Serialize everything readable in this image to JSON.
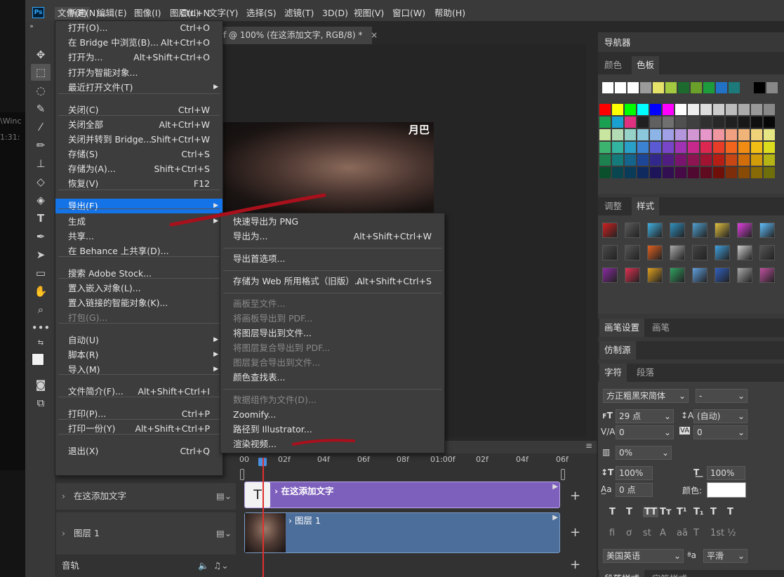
{
  "menubar": {
    "items": [
      "文件(F)",
      "编辑(E)",
      "图像(I)",
      "图层(L)",
      "文字(Y)",
      "选择(S)",
      "滤镜(T)",
      "3D(D)",
      "视图(V)",
      "窗口(W)",
      "帮助(H)"
    ],
    "logo": "Ps"
  },
  "document": {
    "tab_title": "f @ 100% (在这添加文字, RGB/8) *",
    "tab_close": "×",
    "overlay_text": "月巴"
  },
  "ghost_window": {
    "line1": "\\Winc",
    "line2": "1:31:"
  },
  "file_menu": {
    "items": [
      {
        "label": "新建(N)...",
        "shortcut": "Ctrl+N"
      },
      {
        "label": "打开(O)...",
        "shortcut": "Ctrl+O"
      },
      {
        "label": "在 Bridge 中浏览(B)...",
        "shortcut": "Alt+Ctrl+O"
      },
      {
        "label": "打开为...",
        "shortcut": "Alt+Shift+Ctrl+O"
      },
      {
        "label": "打开为智能对象...",
        "shortcut": ""
      },
      {
        "label": "最近打开文件(T)",
        "shortcut": ""
      },
      {
        "label": "关闭(C)",
        "shortcut": "Ctrl+W"
      },
      {
        "label": "关闭全部",
        "shortcut": "Alt+Ctrl+W"
      },
      {
        "label": "关闭并转到 Bridge...",
        "shortcut": "Shift+Ctrl+W"
      },
      {
        "label": "存储(S)",
        "shortcut": "Ctrl+S"
      },
      {
        "label": "存储为(A)...",
        "shortcut": "Shift+Ctrl+S"
      },
      {
        "label": "恢复(V)",
        "shortcut": "F12"
      },
      {
        "label": "导出(E)",
        "shortcut": ""
      },
      {
        "label": "生成",
        "shortcut": ""
      },
      {
        "label": "共享...",
        "shortcut": ""
      },
      {
        "label": "在 Behance 上共享(D)...",
        "shortcut": ""
      },
      {
        "label": "搜索 Adobe Stock...",
        "shortcut": ""
      },
      {
        "label": "置入嵌入对象(L)...",
        "shortcut": ""
      },
      {
        "label": "置入链接的智能对象(K)...",
        "shortcut": ""
      },
      {
        "label": "打包(G)...",
        "shortcut": ""
      },
      {
        "label": "自动(U)",
        "shortcut": ""
      },
      {
        "label": "脚本(R)",
        "shortcut": ""
      },
      {
        "label": "导入(M)",
        "shortcut": ""
      },
      {
        "label": "文件简介(F)...",
        "shortcut": "Alt+Shift+Ctrl+I"
      },
      {
        "label": "打印(P)...",
        "shortcut": "Ctrl+P"
      },
      {
        "label": "打印一份(Y)",
        "shortcut": "Alt+Shift+Ctrl+P"
      },
      {
        "label": "退出(X)",
        "shortcut": "Ctrl+Q"
      }
    ]
  },
  "export_menu": {
    "items": [
      {
        "label": "快速导出为 PNG",
        "shortcut": ""
      },
      {
        "label": "导出为...",
        "shortcut": "Alt+Shift+Ctrl+W"
      },
      {
        "label": "导出首选项...",
        "shortcut": ""
      },
      {
        "label": "存储为 Web 所用格式（旧版）...",
        "shortcut": "Alt+Shift+Ctrl+S"
      },
      {
        "label": "画板至文件...",
        "shortcut": ""
      },
      {
        "label": "将画板导出到 PDF...",
        "shortcut": ""
      },
      {
        "label": "将图层导出到文件...",
        "shortcut": ""
      },
      {
        "label": "将图层复合导出到 PDF...",
        "shortcut": ""
      },
      {
        "label": "图层复合导出到文件...",
        "shortcut": ""
      },
      {
        "label": "颜色查找表...",
        "shortcut": ""
      },
      {
        "label": "数据组作为文件(D)...",
        "shortcut": ""
      },
      {
        "label": "Zoomify...",
        "shortcut": ""
      },
      {
        "label": "路径到 Illustrator...",
        "shortcut": ""
      },
      {
        "label": "渲染视频...",
        "shortcut": ""
      }
    ]
  },
  "timeline": {
    "ruler": [
      "00",
      "02f",
      "04f",
      "06f",
      "08f",
      "01:00f",
      "02f",
      "04f",
      "06f"
    ],
    "tracks": [
      {
        "label": "在这添加文字",
        "clip_label": "在这添加文字"
      },
      {
        "label": "图层 1",
        "clip_label": "图层 1"
      },
      {
        "label": "音轨"
      }
    ],
    "text_clip_glyph": "T"
  },
  "panels": {
    "navigator": "导航器",
    "color_tabs": [
      "颜色",
      "色板"
    ],
    "adjust_tabs": [
      "调整",
      "样式"
    ],
    "brush_tabs": [
      "画笔设置",
      "画笔"
    ],
    "clone_source": "仿制源",
    "char_tabs": [
      "字符",
      "段落"
    ],
    "bottom_tabs": [
      "段落样式",
      "字符样式"
    ],
    "character": {
      "font_family": "方正粗黑宋简体",
      "font_style": "-",
      "size": "29 点",
      "leading": "(自动)",
      "kerning": "0",
      "tracking": "0",
      "tsume": "0%",
      "vscale": "100%",
      "hscale": "100%",
      "baseline": "0 点",
      "color_label": "颜色:",
      "language": "美国英语",
      "antialias": "平滑",
      "aa_icon": "ªa",
      "type_buttons": [
        "T",
        "T",
        "TT",
        "Tт",
        "T¹",
        "T₁",
        "T",
        "T"
      ],
      "ot_buttons": [
        "fi",
        "ơ",
        "st",
        "A",
        "aā",
        "T",
        "1st",
        "½"
      ]
    }
  },
  "colors": {
    "highlight": "#1473e6",
    "annotation_red": "#b01020",
    "text_clip": "#7d5fbc",
    "layer_clip": "#4c6e9a",
    "swatches_row1": [
      "#ffffff",
      "#ffffff",
      "#ffffff",
      "#9b9b9b",
      "#e5e26a",
      "#a3c940",
      "#1c6a2e",
      "#6aa02a",
      "#1c9c3c",
      "#2172c4",
      "#1c7a7a",
      "#3d3d3d",
      "#000000",
      "#888888"
    ],
    "swatches_grid": [
      [
        "#ff0000",
        "#ffff00",
        "#00ff00",
        "#00ffff",
        "#0000ff",
        "#ff00ff",
        "#ffffff",
        "#eeeeee",
        "#dddddd",
        "#cccccc",
        "#bbbbbb",
        "#aaaaaa",
        "#999999",
        "#888888"
      ],
      [
        "#1aa050",
        "#19a0d0",
        "#e03080",
        "#202020",
        "#606060",
        "#707070",
        "#505050",
        "#404040",
        "#303030",
        "#282828",
        "#202020",
        "#181818",
        "#101010",
        "#080808"
      ],
      [
        "#c8e6a0",
        "#b4dcb4",
        "#96d2c8",
        "#8cc8dc",
        "#8cb4e6",
        "#a0a0e6",
        "#b496dc",
        "#d296d2",
        "#e696c8",
        "#f096a0",
        "#f0a080",
        "#f0b478",
        "#f0d278",
        "#e6e682"
      ],
      [
        "#3cb470",
        "#32b4a0",
        "#28a0c8",
        "#3c82d2",
        "#5a5ad2",
        "#7846c8",
        "#a032b4",
        "#c8288c",
        "#dc2850",
        "#e63c28",
        "#f0641e",
        "#f08c14",
        "#f0be14",
        "#dcdc1e"
      ],
      [
        "#1e8250",
        "#147a7a",
        "#14648c",
        "#1e4696",
        "#32288c",
        "#501e82",
        "#78146e",
        "#8c1450",
        "#a01432",
        "#b41e14",
        "#c84614",
        "#d26e0a",
        "#d29b0a",
        "#b4b414"
      ],
      [
        "#0a502d",
        "#0a4650",
        "#0a3c5a",
        "#0f2a5f",
        "#1e145a",
        "#320f50",
        "#460a46",
        "#500a32",
        "#5f0a1e",
        "#6e0f0a",
        "#7d2d0a",
        "#874b05",
        "#876905",
        "#6e6e0a"
      ]
    ],
    "styles_grid": [
      [
        "#d02020",
        "#5a5a5a",
        "#40b0e0",
        "#3090c0",
        "#50a0d0",
        "#e0c040",
        "#e040e0",
        "#60c0ff"
      ],
      [
        "#4a4a4a",
        "#555555",
        "#e06020",
        "#aaa",
        "#444444",
        "#40a0e0",
        "#cccccc",
        "#555555"
      ],
      [
        "#8a2aa0",
        "#e03050",
        "#e0a020",
        "#30a060",
        "#60a0e0",
        "#3060c0",
        "#aaaaaa",
        "#c050a0"
      ]
    ]
  }
}
